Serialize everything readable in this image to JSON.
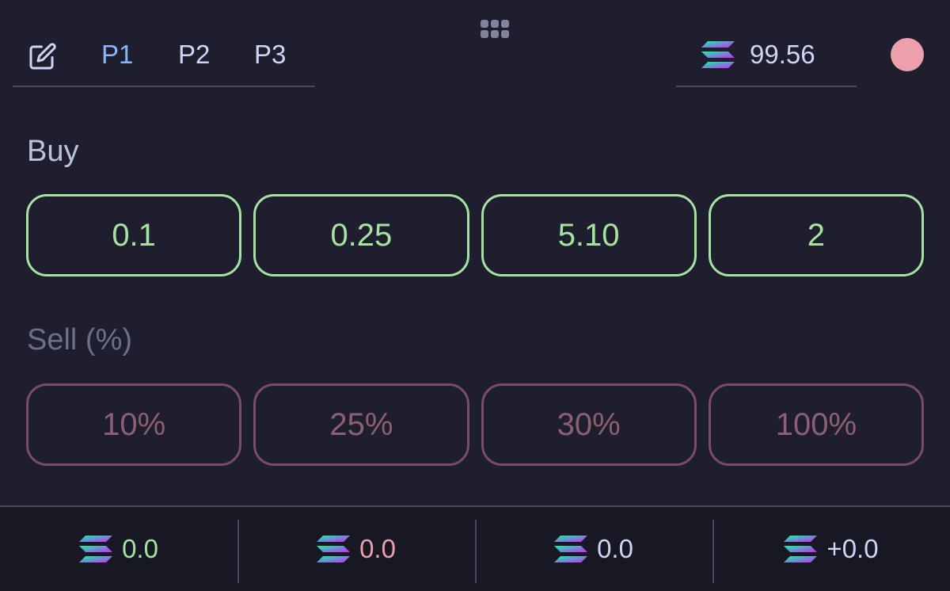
{
  "header": {
    "presets": [
      {
        "label": "P1",
        "active": true
      },
      {
        "label": "P2",
        "active": false
      },
      {
        "label": "P3",
        "active": false
      }
    ],
    "balance": "99.56",
    "status_color": "#eba0ac"
  },
  "buy": {
    "label": "Buy",
    "amounts": [
      "0.1",
      "0.25",
      "5.10",
      "2"
    ]
  },
  "sell": {
    "label": "Sell (%)",
    "amounts": [
      "10%",
      "25%",
      "30%",
      "100%"
    ]
  },
  "footer": {
    "stats": [
      {
        "value": "0.0",
        "color": "#a6e3a1"
      },
      {
        "value": "0.0",
        "color": "#eba0ac"
      },
      {
        "value": "0.0",
        "color": "#cdd6f4"
      },
      {
        "value": "+0.0",
        "color": "#cdd6f4"
      }
    ]
  },
  "icons": {
    "edit": "edit-icon",
    "token": "solana-icon",
    "drag": "drag-handle-icon"
  },
  "colors": {
    "background": "#1e1e2e",
    "buy_accent": "#a6e3a1",
    "sell_accent": "#7a4d63",
    "active_tab": "#89b4fa"
  }
}
